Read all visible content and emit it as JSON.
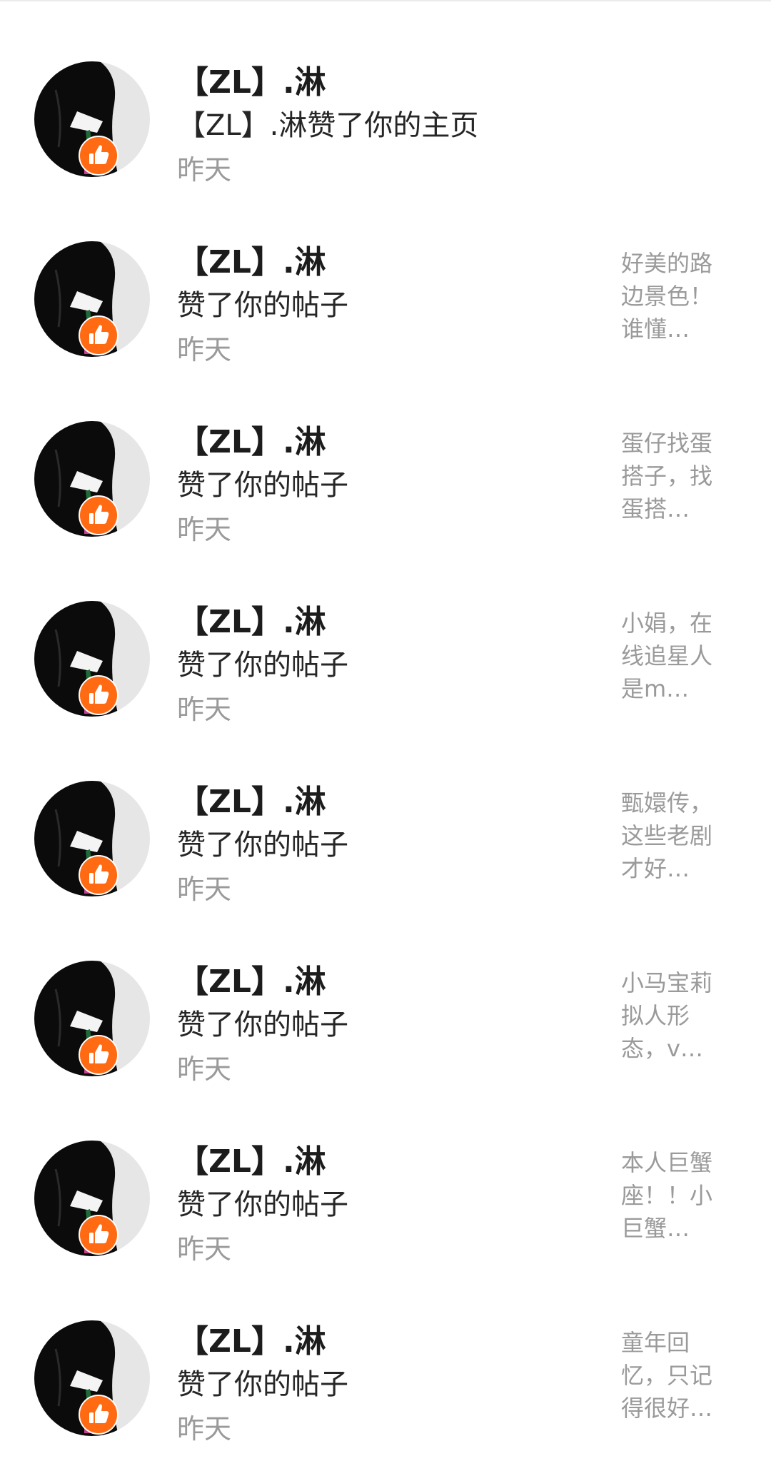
{
  "notifications": [
    {
      "user_name": "【ZL】.淋",
      "action": "【ZL】.淋赞了你的主页",
      "time": "昨天",
      "preview": [
        "",
        "",
        ""
      ],
      "badge_icon": "thumbs-up-icon"
    },
    {
      "user_name": "【ZL】.淋",
      "action": "赞了你的帖子",
      "time": "昨天",
      "preview": [
        "好美的路",
        "边景色！",
        "谁懂…"
      ],
      "badge_icon": "thumbs-up-icon"
    },
    {
      "user_name": "【ZL】.淋",
      "action": "赞了你的帖子",
      "time": "昨天",
      "preview": [
        "蛋仔找蛋",
        "搭子，找",
        "蛋搭…"
      ],
      "badge_icon": "thumbs-up-icon"
    },
    {
      "user_name": "【ZL】.淋",
      "action": "赞了你的帖子",
      "time": "昨天",
      "preview": [
        "小娟，在",
        "线追星人",
        "是m…"
      ],
      "badge_icon": "thumbs-up-icon"
    },
    {
      "user_name": "【ZL】.淋",
      "action": "赞了你的帖子",
      "time": "昨天",
      "preview": [
        "甄嬛传，",
        "这些老剧",
        "才好…"
      ],
      "badge_icon": "thumbs-up-icon"
    },
    {
      "user_name": "【ZL】.淋",
      "action": "赞了你的帖子",
      "time": "昨天",
      "preview": [
        "小马宝莉",
        "拟人形",
        "态，v…"
      ],
      "badge_icon": "thumbs-up-icon"
    },
    {
      "user_name": "【ZL】.淋",
      "action": "赞了你的帖子",
      "time": "昨天",
      "preview": [
        "本人巨蟹",
        "座！！小",
        "巨蟹…"
      ],
      "badge_icon": "thumbs-up-icon"
    },
    {
      "user_name": "【ZL】.淋",
      "action": "赞了你的帖子",
      "time": "昨天",
      "preview": [
        "童年回",
        "忆，只记",
        "得很好…"
      ],
      "badge_icon": "thumbs-up-icon"
    }
  ],
  "colors": {
    "badge": "#ff6a13",
    "name": "#1c1c1c",
    "secondary": "#9a9a9a"
  }
}
